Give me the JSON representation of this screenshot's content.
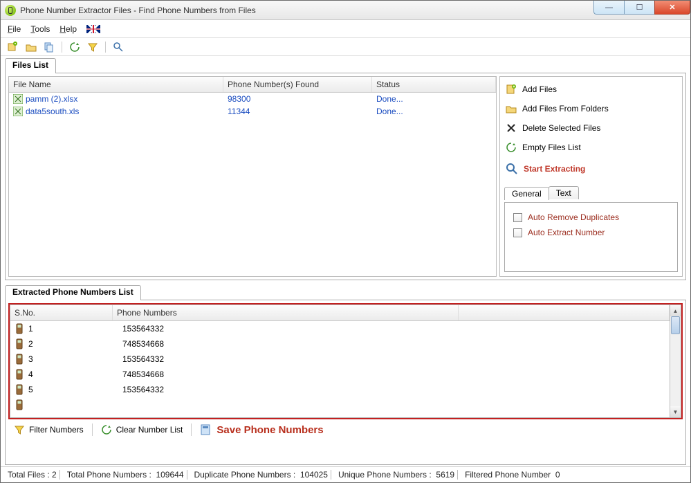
{
  "window": {
    "title": "Phone Number Extractor Files - Find Phone Numbers from Files"
  },
  "menu": {
    "file": "File",
    "tools": "Tools",
    "help": "Help"
  },
  "tabs": {
    "filesList": "Files List",
    "extracted": "Extracted Phone Numbers List"
  },
  "filesTable": {
    "headers": {
      "fileName": "File Name",
      "found": "Phone Number(s) Found",
      "status": "Status"
    },
    "rows": [
      {
        "name": "pamm (2).xlsx",
        "count": "98300",
        "status": "Done..."
      },
      {
        "name": "data5south.xls",
        "count": "11344",
        "status": "Done..."
      }
    ]
  },
  "sidebar": {
    "addFiles": "Add Files",
    "addFolders": "Add Files From Folders",
    "deleteSelected": "Delete Selected Files",
    "emptyList": "Empty Files List",
    "start": "Start Extracting",
    "subtabs": {
      "general": "General",
      "text": "Text"
    },
    "options": {
      "autoRemove": "Auto Remove Duplicates",
      "autoExtract": "Auto Extract Number"
    }
  },
  "numbersTable": {
    "headers": {
      "sno": "S.No.",
      "phone": "Phone Numbers"
    },
    "rows": [
      {
        "sno": "1",
        "phone": "153564332"
      },
      {
        "sno": "2",
        "phone": "748534668"
      },
      {
        "sno": "3",
        "phone": "153564332"
      },
      {
        "sno": "4",
        "phone": "748534668"
      },
      {
        "sno": "5",
        "phone": "153564332"
      }
    ]
  },
  "bottom": {
    "filter": "Filter Numbers",
    "clear": "Clear Number List",
    "save": "Save Phone Numbers"
  },
  "status": {
    "totalFilesLabel": "Total Files :",
    "totalFiles": "2",
    "totalNumsLabel": "Total Phone Numbers :",
    "totalNums": "109644",
    "dupLabel": "Duplicate Phone Numbers :",
    "dup": "104025",
    "uniqLabel": "Unique Phone Numbers :",
    "uniq": "5619",
    "filtLabel": "Filtered Phone Number",
    "filt": "0"
  }
}
